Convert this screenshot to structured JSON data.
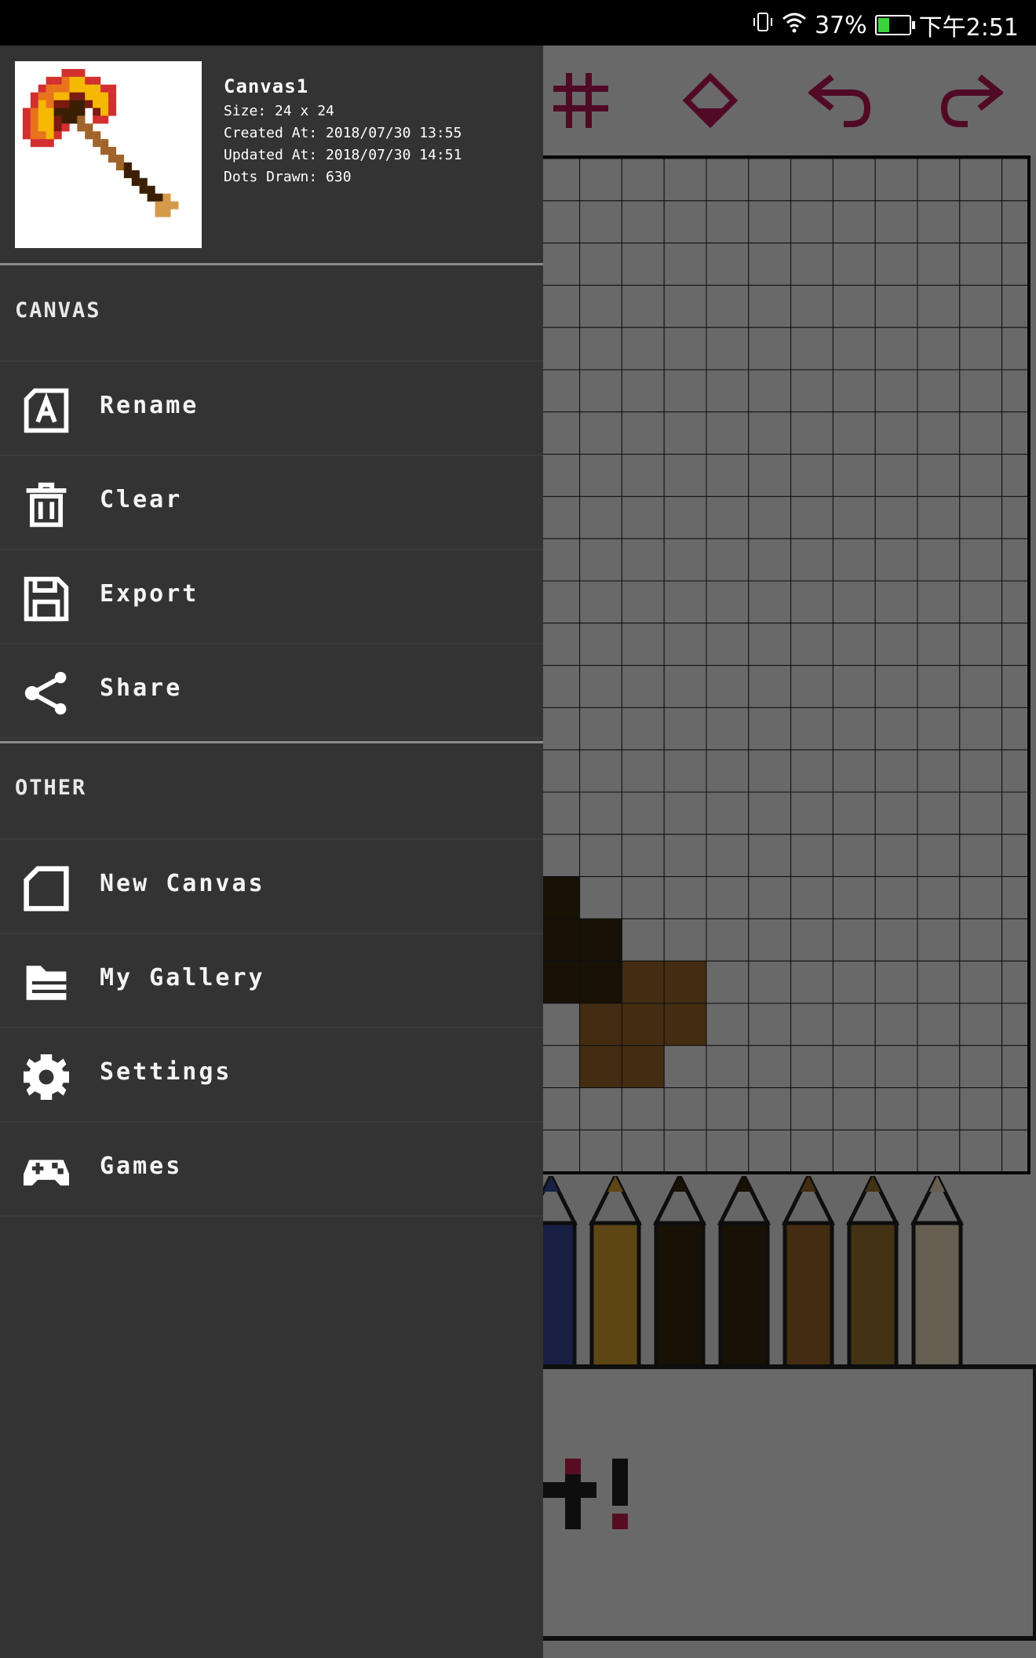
{
  "status_bar": {
    "battery": "37%",
    "time": "下午2:51",
    "battery_fill_fraction": 0.37
  },
  "drawer": {
    "canvas_info": {
      "title": "Canvas1",
      "size": "Size: 24 x 24",
      "created": "Created At: 2018/07/30 13:55",
      "updated": "Updated At: 2018/07/30 14:51",
      "dots": "Dots Drawn: 630"
    },
    "section_canvas": "CANVAS",
    "canvas_items": [
      {
        "label": "Rename",
        "icon": "rename-icon"
      },
      {
        "label": "Clear",
        "icon": "trash-icon"
      },
      {
        "label": "Export",
        "icon": "save-icon"
      },
      {
        "label": "Share",
        "icon": "share-icon"
      }
    ],
    "section_other": "OTHER",
    "other_items": [
      {
        "label": "New Canvas",
        "icon": "new-canvas-icon"
      },
      {
        "label": "My Gallery",
        "icon": "folder-icon"
      },
      {
        "label": "Settings",
        "icon": "gear-icon"
      },
      {
        "label": "Games",
        "icon": "gamepad-icon"
      }
    ]
  },
  "toolbar_icons": [
    "grid-toggle-icon",
    "fill-bucket-icon",
    "undo-icon",
    "redo-icon"
  ],
  "colors": {
    "drawer_bg": "#333333",
    "accent": "#d02050",
    "grid_line": "#222222"
  }
}
